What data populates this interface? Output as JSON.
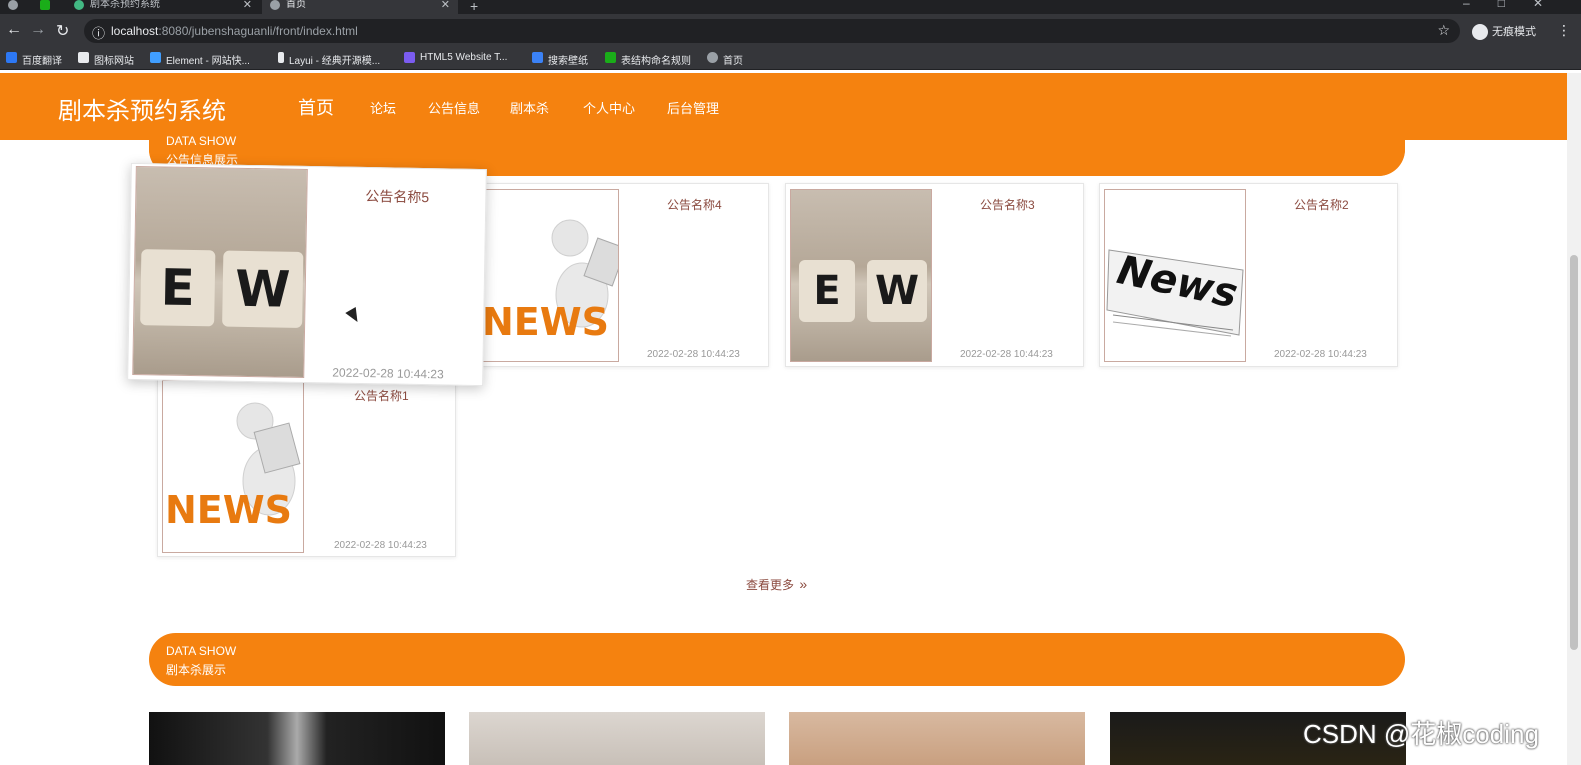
{
  "browser": {
    "tabs": [
      {
        "title": ""
      },
      {
        "title": ""
      },
      {
        "title": "剧本杀预约系统"
      },
      {
        "title": "首页"
      }
    ],
    "new_tab": "+",
    "url_host": "localhost",
    "url_rest": ":8080/jubenshaguanli/front/index.html",
    "incognito_label": "无痕模式",
    "bookmarks": [
      {
        "label": "百度翻译",
        "color": "#2d78f4"
      },
      {
        "label": "图标网站",
        "color": "#e8eaed"
      },
      {
        "label": "Element - 网站快...",
        "color": "#409eff"
      },
      {
        "label": "Layui - 经典开源模...",
        "color": "#e8eaed"
      },
      {
        "label": "HTML5 Website T...",
        "color": "#7b5cf0"
      },
      {
        "label": "搜索壁纸",
        "color": "#3b82f6"
      },
      {
        "label": "表结构命名规则",
        "color": "#1aad19"
      },
      {
        "label": "首页",
        "color": "#9aa0a6"
      }
    ]
  },
  "header": {
    "title": "剧本杀预约系统",
    "nav": [
      "首页",
      "论坛",
      "公告信息",
      "剧本杀",
      "个人中心",
      "后台管理"
    ],
    "bg_color": "#f5820f"
  },
  "notice_section": {
    "en": "DATA SHOW",
    "cn": "公告信息展示",
    "cards": [
      {
        "name": "公告名称5",
        "date": "2022-02-28 10:44:23",
        "image": "ew-blocks"
      },
      {
        "name": "公告名称4",
        "date": "2022-02-28 10:44:23",
        "image": "news-figure"
      },
      {
        "name": "公告名称3",
        "date": "2022-02-28 10:44:23",
        "image": "ew-blocks"
      },
      {
        "name": "公告名称2",
        "date": "2022-02-28 10:44:23",
        "image": "newspaper"
      },
      {
        "name": "公告名称1",
        "date": "2022-02-28 10:44:23",
        "image": "news-figure"
      }
    ],
    "more_label": "查看更多",
    "more_icon": "double-chevron-right-icon"
  },
  "script_section": {
    "en": "DATA SHOW",
    "cn": "剧本杀展示"
  },
  "watermark": "CSDN @花椒coding"
}
